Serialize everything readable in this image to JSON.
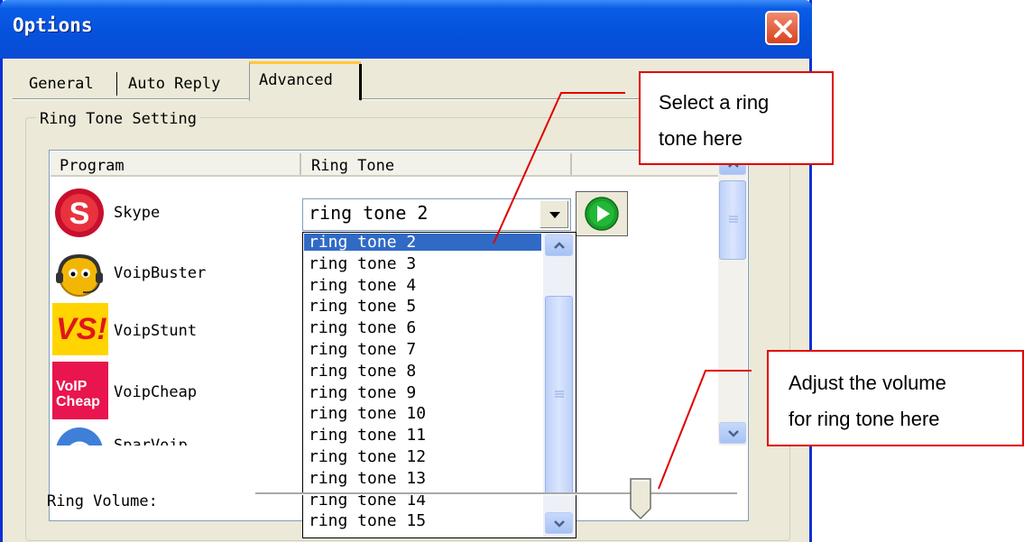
{
  "window": {
    "title": "Options"
  },
  "tabs": [
    {
      "label": "General"
    },
    {
      "label": "Auto Reply"
    },
    {
      "label": "Advanced",
      "selected": true
    }
  ],
  "ring_tone_setting": {
    "group_label": "Ring Tone Setting",
    "columns": [
      "Program",
      "Ring Tone"
    ],
    "programs": [
      {
        "name": "Skype",
        "icon": "skype-icon"
      },
      {
        "name": "VoipBuster",
        "icon": "voipbuster-icon"
      },
      {
        "name": "VoipStunt",
        "icon": "voipstunt-icon"
      },
      {
        "name": "VoipCheap",
        "icon": "voipcheap-icon"
      },
      {
        "name": "SparVoip",
        "icon": "sparvoip-icon"
      }
    ],
    "selected_ring_tone": "ring tone 2",
    "dropdown_options": [
      "ring tone 2",
      "ring tone 3",
      "ring tone 4",
      "ring tone 5",
      "ring tone 6",
      "ring tone 7",
      "ring tone 8",
      "ring tone 9",
      "ring tone 10",
      "ring tone 11",
      "ring tone 12",
      "ring tone 13",
      "ring tone 14",
      "ring tone 15"
    ],
    "highlighted_option": "ring tone 2"
  },
  "volume": {
    "label": "Ring Volume:",
    "level": 0.8
  },
  "icon_text": {
    "voipstunt": "VS!",
    "voipcheap_line1": "VoIP",
    "voipcheap_line2": "Cheap"
  },
  "callouts": {
    "ring_tone_line1": "Select  a  ring",
    "ring_tone_line2": "tone here",
    "volume_line1": "Adjust   the   volume",
    "volume_line2": "for ring tone here"
  },
  "colors": {
    "titlebar": "#0552dd",
    "selection": "#316ac5",
    "callout_border": "#e00000",
    "active_tab_accent": "#ffc83c"
  }
}
